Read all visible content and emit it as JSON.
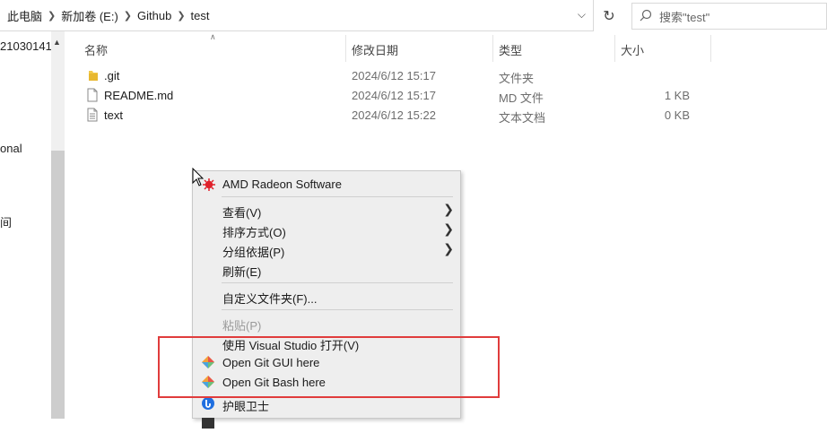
{
  "address": {
    "crumbs": [
      "此电脑",
      "新加卷 (E:)",
      "Github",
      "test"
    ]
  },
  "search": {
    "placeholder": "搜索\"test\""
  },
  "nav": {
    "items": [
      "21030141",
      "",
      "onal",
      "间"
    ]
  },
  "columns": {
    "name": "名称",
    "modified": "修改日期",
    "type": "类型",
    "size": "大小"
  },
  "files": [
    {
      "name": ".git",
      "modified": "2024/6/12 15:17",
      "type": "文件夹",
      "size": "",
      "icon": "folder-icon"
    },
    {
      "name": "README.md",
      "modified": "2024/6/12 15:17",
      "type": "MD 文件",
      "size": "1 KB",
      "icon": "file-icon"
    },
    {
      "name": "text",
      "modified": "2024/6/12 15:22",
      "type": "文本文档",
      "size": "0 KB",
      "icon": "text-file-icon"
    }
  ],
  "menu": {
    "amd": "AMD Radeon Software",
    "view": "查看(V)",
    "sort": "排序方式(O)",
    "group": "分组依据(P)",
    "refresh": "刷新(E)",
    "customize": "自定义文件夹(F)...",
    "paste": "粘贴(P)",
    "vs": "使用 Visual Studio 打开(V)",
    "git_gui": "Open Git GUI here",
    "git_bash": "Open Git Bash here",
    "eye": "护眼卫士"
  },
  "colors": {
    "highlight_border": "#e03c3c",
    "menu_bg": "#eeeeee"
  }
}
